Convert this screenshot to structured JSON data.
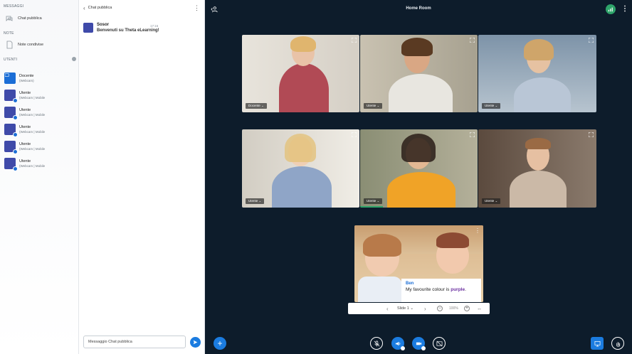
{
  "sidebar": {
    "messages_title": "MESSAGGI",
    "public_chat_label": "Chat pubblica",
    "notes_title": "NOTE",
    "shared_notes_label": "Note condivise",
    "users_title": "UTENTI",
    "users": [
      {
        "name": "Docente",
        "sub": "(Webcam)",
        "icon": "presenter-icon"
      },
      {
        "name": "Utente",
        "sub": "(Webcam | Mobile"
      },
      {
        "name": "Utente",
        "sub": "(Webcam | Mobile"
      },
      {
        "name": "Utente",
        "sub": "(Webcam | Mobile"
      },
      {
        "name": "Utente",
        "sub": "(Webcam | Mobile"
      },
      {
        "name": "Utente",
        "sub": "(Webcam | Mobile"
      }
    ]
  },
  "chat": {
    "title": "Chat pubblica",
    "message": {
      "sender": "Sosor",
      "time": "17:16",
      "text": "Benvenuti su Theta eLearning!"
    },
    "input_value": "Messaggio Chat pubblica"
  },
  "room": {
    "title": "Home Room",
    "tiles": [
      {
        "label": "Docente"
      },
      {
        "label": "Utente"
      },
      {
        "label": "Utente"
      },
      {
        "label": "Utente"
      },
      {
        "label": "Utente"
      },
      {
        "label": "Utente"
      }
    ],
    "presentation": {
      "caption_name": "Ben",
      "caption_text_prefix": "My favourite colour is ",
      "caption_text_emph": "purple",
      "caption_text_suffix": ".",
      "slide_label": "Slide 1",
      "zoom": "100%"
    }
  },
  "colors": {
    "accent": "#1b7ce0",
    "dark_bg": "#0d1c2b",
    "avatar": "#3f4aa9",
    "status_green": "#2ea46a"
  }
}
